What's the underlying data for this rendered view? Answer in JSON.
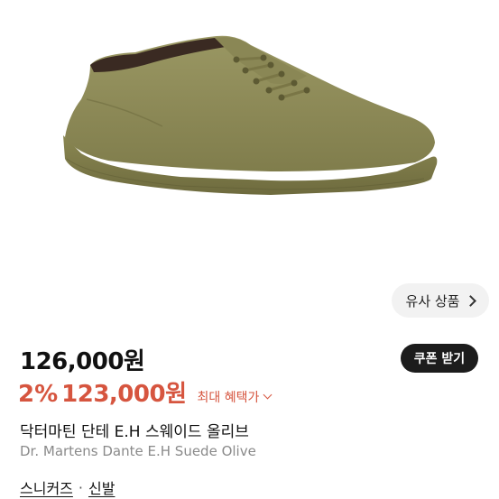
{
  "product": {
    "similar_button_label": "유사 상품",
    "price": "126,000원",
    "coupon_button_label": "쿠폰 받기",
    "discount_percent": "2%",
    "discount_price": "123,000원",
    "max_benefit_label": "최대 혜택가",
    "name_ko": "닥터마틴 단테 E.H 스웨이드 올리브",
    "name_en": "Dr. Martens Dante E.H Suede Olive",
    "categories": [
      "스니커즈",
      "신발"
    ],
    "category_separator": "·"
  },
  "icons": {
    "similar_chevron": "chevron-right-icon",
    "benefit_chevron": "chevron-down-icon"
  },
  "colors": {
    "accent_red": "#d6553f",
    "coupon_bg": "#1c1c1c",
    "chip_bg": "#f2f2f2",
    "shoe_olive": "#8c8a58"
  }
}
